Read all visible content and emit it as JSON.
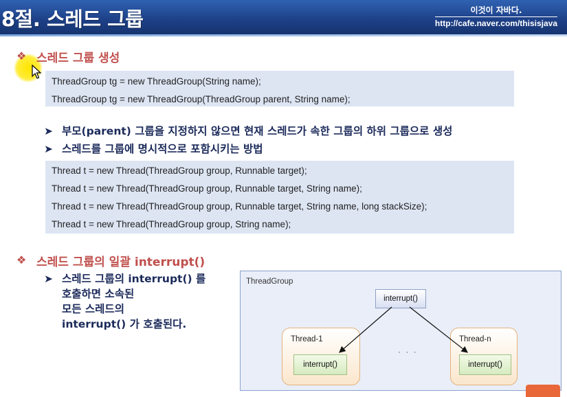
{
  "header": {
    "title": "8절. 스레드 그룹",
    "brand_line1": "이것이 자바다.",
    "brand_line2": "http://cafe.naver.com/thisisjava"
  },
  "colors": {
    "header_blue": "#1d3f86",
    "section_red": "#c0504d",
    "text_navy": "#1b2a5a",
    "code_box_bg": "#dde5f3"
  },
  "section1": {
    "bullet": "❖",
    "title": "스레드 그룹 생성",
    "code_lines": [
      "ThreadGroup tg = new ThreadGroup(String  name);",
      "ThreadGroup tg = new ThreadGroup(ThreadGroup  parent, String name);"
    ],
    "points": [
      "부모(parent) 그룹을 지정하지 않으면 현재 스레드가 속한 그룹의 하위 그룹으로 생성",
      "스레드를 그룹에 명시적으로 포함시키는 방법"
    ],
    "code_lines2": [
      "Thread t = new Thread(ThreadGroup  group, Runnable target);",
      "Thread t = new Thread(ThreadGroup  group, Runnable target, String name);",
      "Thread t = new Thread(ThreadGroup  group, Runnable target, String name, long stackSize);",
      "Thread t = new Thread(ThreadGroup  group, String name);"
    ]
  },
  "section2": {
    "bullet": "❖",
    "title": "스레드 그룹의 일괄 interrupt()",
    "point_lines": [
      "스레드 그룹의 interrupt() 를",
      "호출하면 소속된",
      "모든 스레드의",
      "interrupt() 가 호출된다."
    ]
  },
  "diagram": {
    "group_label": "ThreadGroup",
    "top_method": "interrupt()",
    "thread1_label": "Thread-1",
    "thread1_method": "interrupt()",
    "threadn_label": "Thread-n",
    "threadn_method": "interrupt()",
    "dots": "· · ·"
  },
  "icons": {
    "arrow": "arrow-right-icon",
    "diamond": "diamond-bullet-icon",
    "cursor": "mouse-cursor-icon"
  }
}
